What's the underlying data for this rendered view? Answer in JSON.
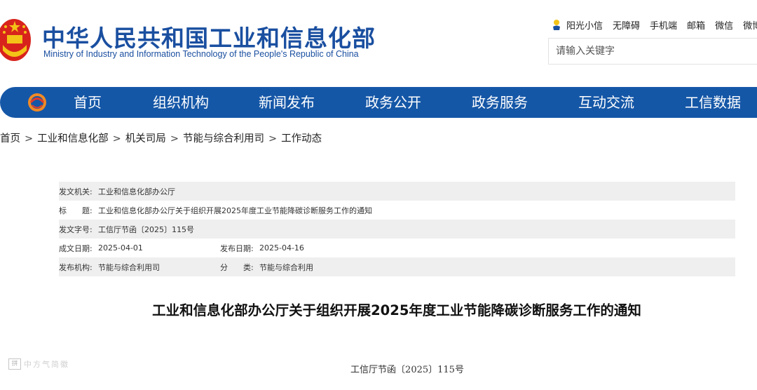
{
  "header": {
    "title_cn": "中华人民共和国工业和信息化部",
    "title_en": "Ministry of Industry and Information Technology of the People's Republic of China",
    "toplinks": [
      "阳光小信",
      "无障碍",
      "手机端",
      "邮箱",
      "微信",
      "微博"
    ],
    "search_placeholder": "请输入关键字"
  },
  "nav": {
    "items": [
      "首页",
      "组织机构",
      "新闻发布",
      "政务公开",
      "政务服务",
      "互动交流",
      "工信数据"
    ]
  },
  "breadcrumb": [
    "首页",
    "工业和信息化部",
    "机关司局",
    "节能与综合利用司",
    "工作动态"
  ],
  "info": {
    "issuer_label": "发文机关:",
    "issuer": "工业和信息化部办公厅",
    "title_label": "标　　题:",
    "title": "工业和信息化部办公厅关于组织开展2025年度工业节能降碳诊断服务工作的通知",
    "docno_label": "发文字号:",
    "docno": "工信厅节函〔2025〕115号",
    "written_label": "成文日期:",
    "written": "2025-04-01",
    "published_label": "发布日期:",
    "published": "2025-04-16",
    "org_label": "发布机构:",
    "org": "节能与综合利用司",
    "category_label": "分　　类:",
    "category": "节能与综合利用"
  },
  "document": {
    "title": "工业和信息化部办公厅关于组织开展2025年度工业节能降碳诊断服务工作的通知",
    "number": "工信厅节函〔2025〕115号"
  },
  "watermark": {
    "box": "拼",
    "text": "中方气简徽"
  },
  "colors": {
    "brand_blue": "#1a4fa0",
    "nav_blue": "#1557a7",
    "emblem_red": "#d8231c",
    "emblem_gold": "#f3c317"
  }
}
